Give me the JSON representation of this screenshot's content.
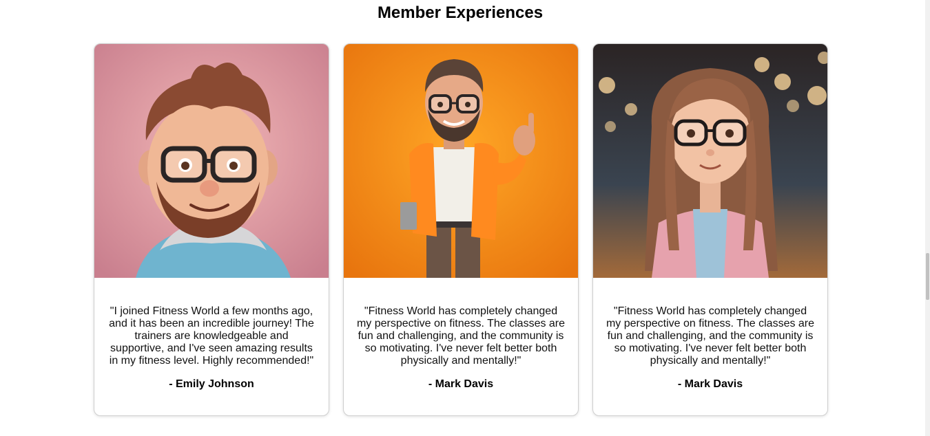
{
  "section": {
    "title": "Member Experiences"
  },
  "testimonials": [
    {
      "avatar": "bearded-man-glasses-avatar",
      "quote": "\"I joined Fitness World a few months ago, and it has been an incredible journey! The trainers are knowledgeable and supportive, and I've seen amazing results in my fitness level. Highly recommended!\"",
      "author": "- Emily Johnson",
      "background": "#d98e96"
    },
    {
      "avatar": "man-orange-jacket-avatar",
      "quote": "\"Fitness World has completely changed my perspective on fitness. The classes are fun and challenging, and the community is so motivating. I've never felt better both physically and mentally!\"",
      "author": "- Mark Davis",
      "background": "#f28a1c"
    },
    {
      "avatar": "girl-long-hair-glasses-avatar",
      "quote": "\"Fitness World has completely changed my perspective on fitness. The classes are fun and challenging, and the community is so motivating. I've never felt better both physically and mentally!\"",
      "author": "- Mark Davis",
      "background": "#2a2a30"
    }
  ]
}
